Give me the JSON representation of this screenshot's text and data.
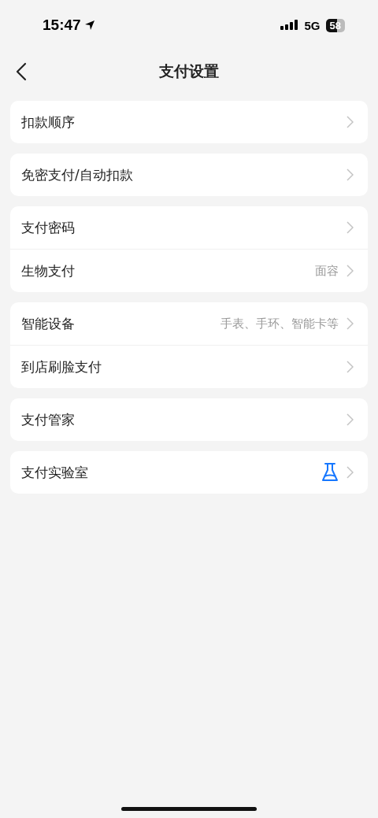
{
  "status_bar": {
    "time": "15:47",
    "network": "5G",
    "battery": "58"
  },
  "header": {
    "title": "支付设置"
  },
  "groups": [
    {
      "items": [
        {
          "kind": "text",
          "label": "扣款顺序"
        }
      ]
    },
    {
      "items": [
        {
          "kind": "text",
          "label": "免密支付/自动扣款"
        }
      ]
    },
    {
      "items": [
        {
          "kind": "text",
          "label": "支付密码"
        },
        {
          "kind": "text",
          "label": "生物支付",
          "value": "面容"
        }
      ]
    },
    {
      "items": [
        {
          "kind": "text",
          "label": "智能设备",
          "value": "手表、手环、智能卡等"
        },
        {
          "kind": "text",
          "label": "到店刷脸支付"
        }
      ]
    },
    {
      "items": [
        {
          "kind": "text",
          "label": "支付管家"
        }
      ]
    },
    {
      "items": [
        {
          "kind": "flask",
          "label": "支付实验室"
        }
      ]
    }
  ]
}
